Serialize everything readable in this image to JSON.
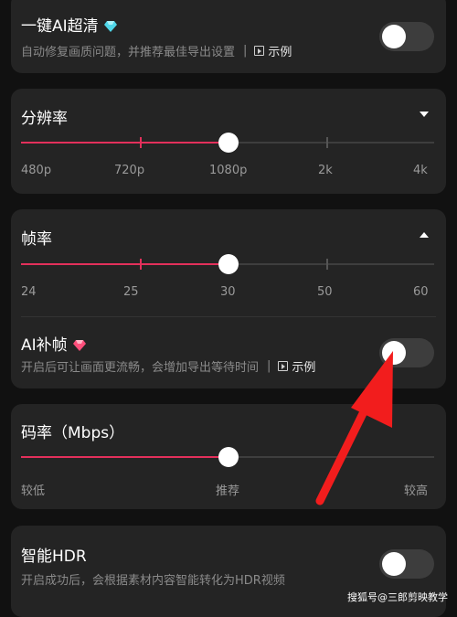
{
  "colors": {
    "accent": "#e3305b",
    "card": "#242424",
    "background": "#111111"
  },
  "enhance": {
    "title": "一键AI超清",
    "badge_icon": "diamond-icon",
    "desc": "自动修复画质问题，并推荐最佳导出设置",
    "example": "示例",
    "toggle_on": false
  },
  "resolution": {
    "title": "分辨率",
    "labels": [
      "480p",
      "720p",
      "1080p",
      "2k",
      "4k"
    ],
    "selected": "1080p"
  },
  "framerate": {
    "title": "帧率",
    "labels": [
      "24",
      "25",
      "30",
      "50",
      "60"
    ],
    "selected": "30"
  },
  "ai_frame": {
    "title": "AI补帧",
    "badge_icon": "diamond-icon",
    "desc": "开启后可让画面更流畅，会增加导出等待时间",
    "example": "示例",
    "toggle_on": false
  },
  "bitrate": {
    "title": "码率（Mbps）",
    "labels": [
      "较低",
      "推荐",
      "较高"
    ],
    "level": 0.5
  },
  "hdr": {
    "title": "智能HDR",
    "desc": "开启成功后，会根据素材内容智能转化为HDR视频",
    "toggle_on": false
  },
  "watermark": "搜狐号@三郎剪映教学"
}
